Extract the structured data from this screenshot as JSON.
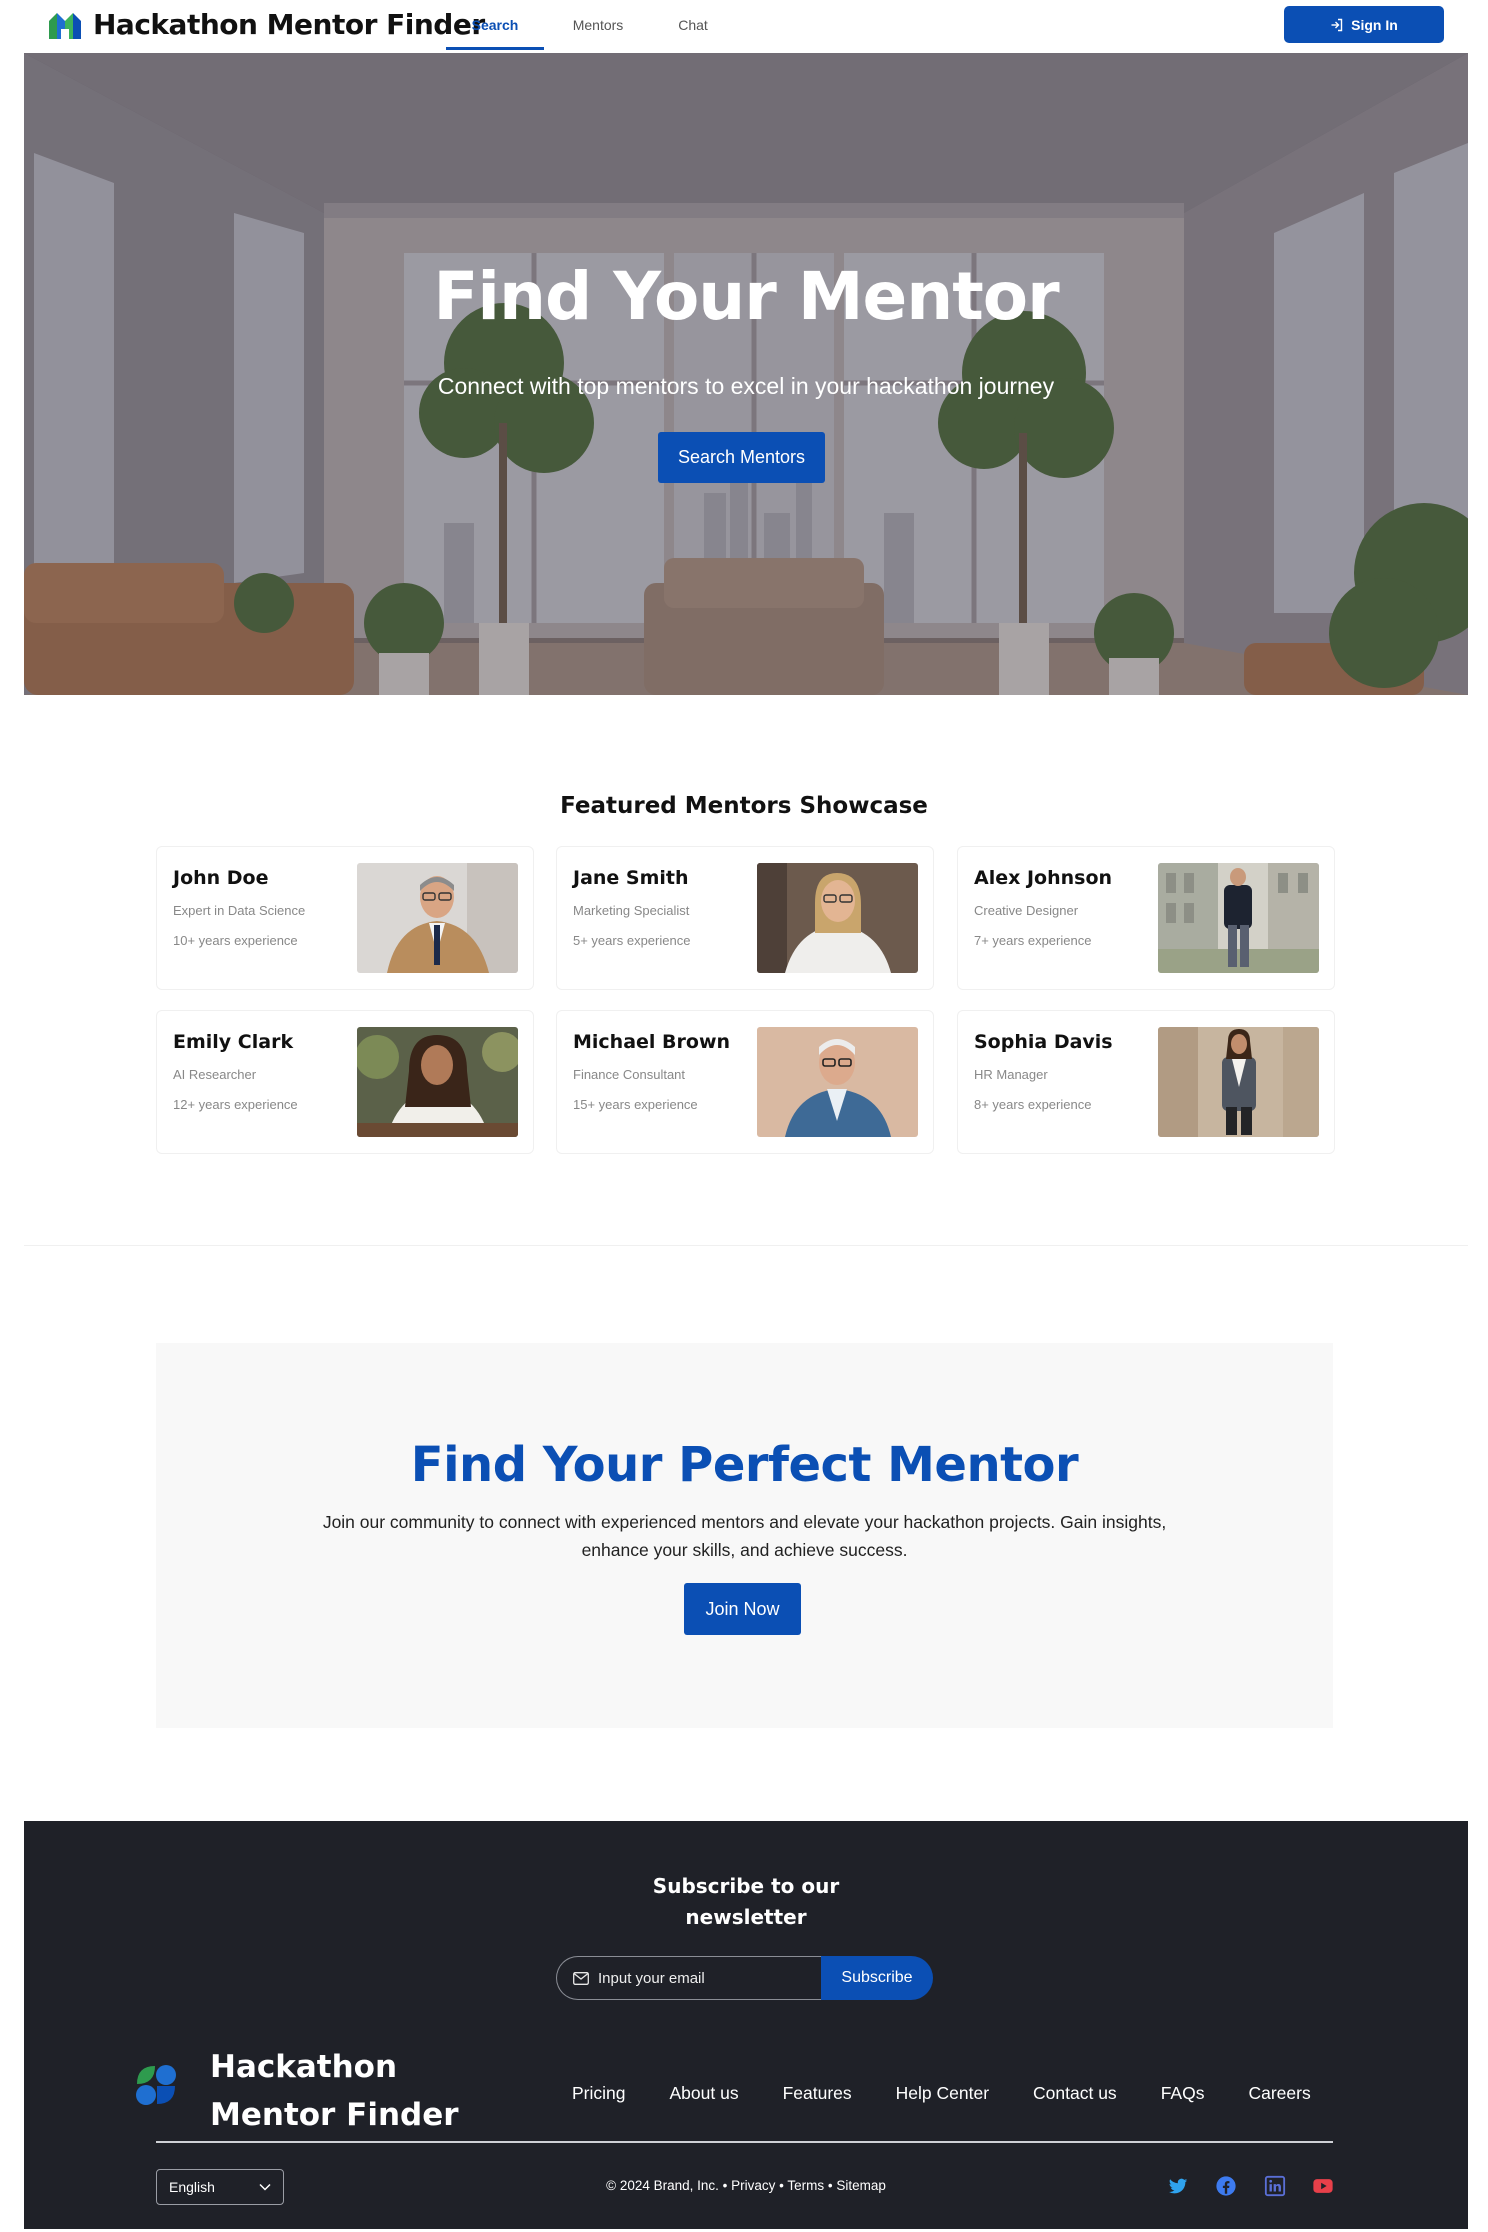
{
  "header": {
    "brand": "Hackathon Mentor Finder",
    "tabs": [
      {
        "label": "Search",
        "active": true
      },
      {
        "label": "Mentors",
        "active": false
      },
      {
        "label": "Chat",
        "active": false
      }
    ],
    "sign_in_label": "Sign In",
    "accent_color": "#0b4fb4"
  },
  "hero": {
    "title": "Find Your Mentor",
    "subtitle": "Connect with top mentors to excel in your hackathon journey",
    "button_label": "Search Mentors"
  },
  "featured": {
    "title": "Featured Mentors Showcase",
    "mentors": [
      {
        "name": "John Doe",
        "role": "Expert in Data Science",
        "experience": "10+ years experience"
      },
      {
        "name": "Jane Smith",
        "role": "Marketing Specialist",
        "experience": "5+ years experience"
      },
      {
        "name": "Alex Johnson",
        "role": "Creative Designer",
        "experience": "7+ years experience"
      },
      {
        "name": "Emily Clark",
        "role": "AI Researcher",
        "experience": "12+ years experience"
      },
      {
        "name": "Michael Brown",
        "role": "Finance Consultant",
        "experience": "15+ years experience"
      },
      {
        "name": "Sophia Davis",
        "role": "HR Manager",
        "experience": "8+ years experience"
      }
    ]
  },
  "cta": {
    "title": "Find Your Perfect Mentor",
    "body": "Join our community to connect with experienced mentors and elevate your hackathon projects. Gain insights, enhance your skills, and achieve success.",
    "button_label": "Join Now"
  },
  "footer": {
    "newsletter_title_line1": "Subscribe to our",
    "newsletter_title_line2": "newsletter",
    "email_placeholder": "Input your email",
    "subscribe_label": "Subscribe",
    "brand": "Hackathon Mentor Finder",
    "links": [
      "Pricing",
      "About us",
      "Features",
      "Help Center",
      "Contact us",
      "FAQs",
      "Careers"
    ],
    "language": "English",
    "copyright": "© 2024 Brand, Inc. • Privacy • Terms • Sitemap",
    "social_icons": [
      "twitter-icon",
      "facebook-icon",
      "linkedin-icon",
      "youtube-icon"
    ],
    "background_color": "#1f2128"
  }
}
